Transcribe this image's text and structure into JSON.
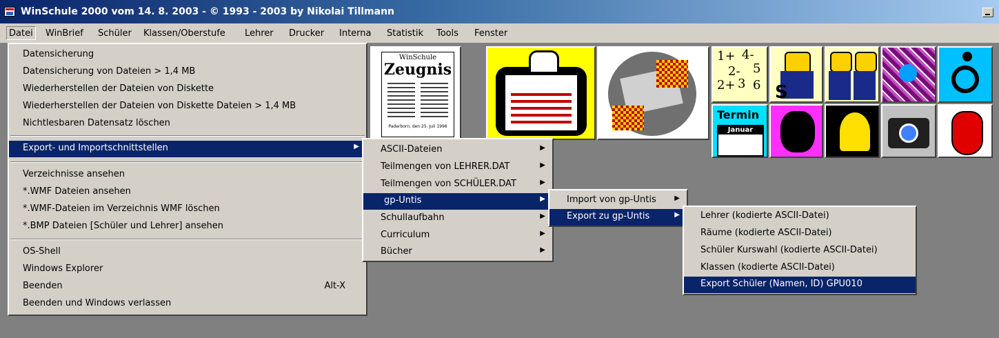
{
  "window": {
    "title": "WinSchule 2000 vom 14. 8. 2003 -   © 1993 - 2003 by Nikolai Tillmann",
    "minimize_icon": "minimize-icon",
    "app_icon": "app-icon"
  },
  "menubar": [
    "Datei",
    "WinBrief",
    "Schüler",
    "Klassen/Oberstufe",
    "Lehrer",
    "Drucker",
    "Interna",
    "Statistik",
    "Tools",
    "Fenster"
  ],
  "datei_menu": {
    "group1": [
      "Datensicherung",
      "Datensicherung von Dateien > 1,4 MB",
      "Wiederherstellen der Dateien von Diskette",
      "Wiederherstellen der Dateien von Diskette Dateien > 1,4 MB",
      "Nichtlesbaren Datensatz löschen"
    ],
    "export_item": "Export- und Importschnittstellen",
    "group3": [
      "Verzeichnisse ansehen",
      "*.WMF Dateien ansehen",
      "*.WMF-Dateien im Verzeichnis WMF löschen",
      "*.BMP Dateien [Schüler und Lehrer] ansehen"
    ],
    "group4": [
      "OS-Shell",
      "Windows Explorer",
      "Beenden",
      "Beenden und Windows verlassen"
    ],
    "beenden_shortcut": "Alt-X"
  },
  "export_submenu": [
    "ASCII-Dateien",
    "Teilmengen von LEHRER.DAT",
    "Teilmengen von SCHÜLER.DAT",
    "gp-Untis",
    "Schullaufbahn",
    "Curriculum",
    "Bücher"
  ],
  "gpuntis_submenu": [
    "Import von gp-Untis",
    "Export zu gp-Untis"
  ],
  "export_gpuntis_submenu": [
    "Lehrer (kodierte ASCII-Datei)",
    "Räume (kodierte ASCII-Datei)",
    "Schüler Kurswahl (kodierte ASCII-Datei)",
    "Klassen (kodierte ASCII-Datei)",
    "Export Schüler (Namen, ID) GPU010"
  ],
  "submenu_arrow": "▶",
  "toolbar_tiles": {
    "zeugnis": {
      "header": "WinSchule",
      "title": "Zeugnis",
      "footer": "Paderborn, den 25. Juli 1996"
    },
    "math": {
      "a": "1+",
      "b": "4-",
      "c": "2-",
      "d": "5",
      "e": "2+",
      "f": "3",
      "g": "6"
    },
    "termin": {
      "title": "Termin",
      "month": "Januar"
    }
  },
  "colors": {
    "highlight": "#0a246a",
    "menu_bg": "#d4d0c8",
    "workspace": "#808080",
    "title_left": "#0a246a"
  }
}
